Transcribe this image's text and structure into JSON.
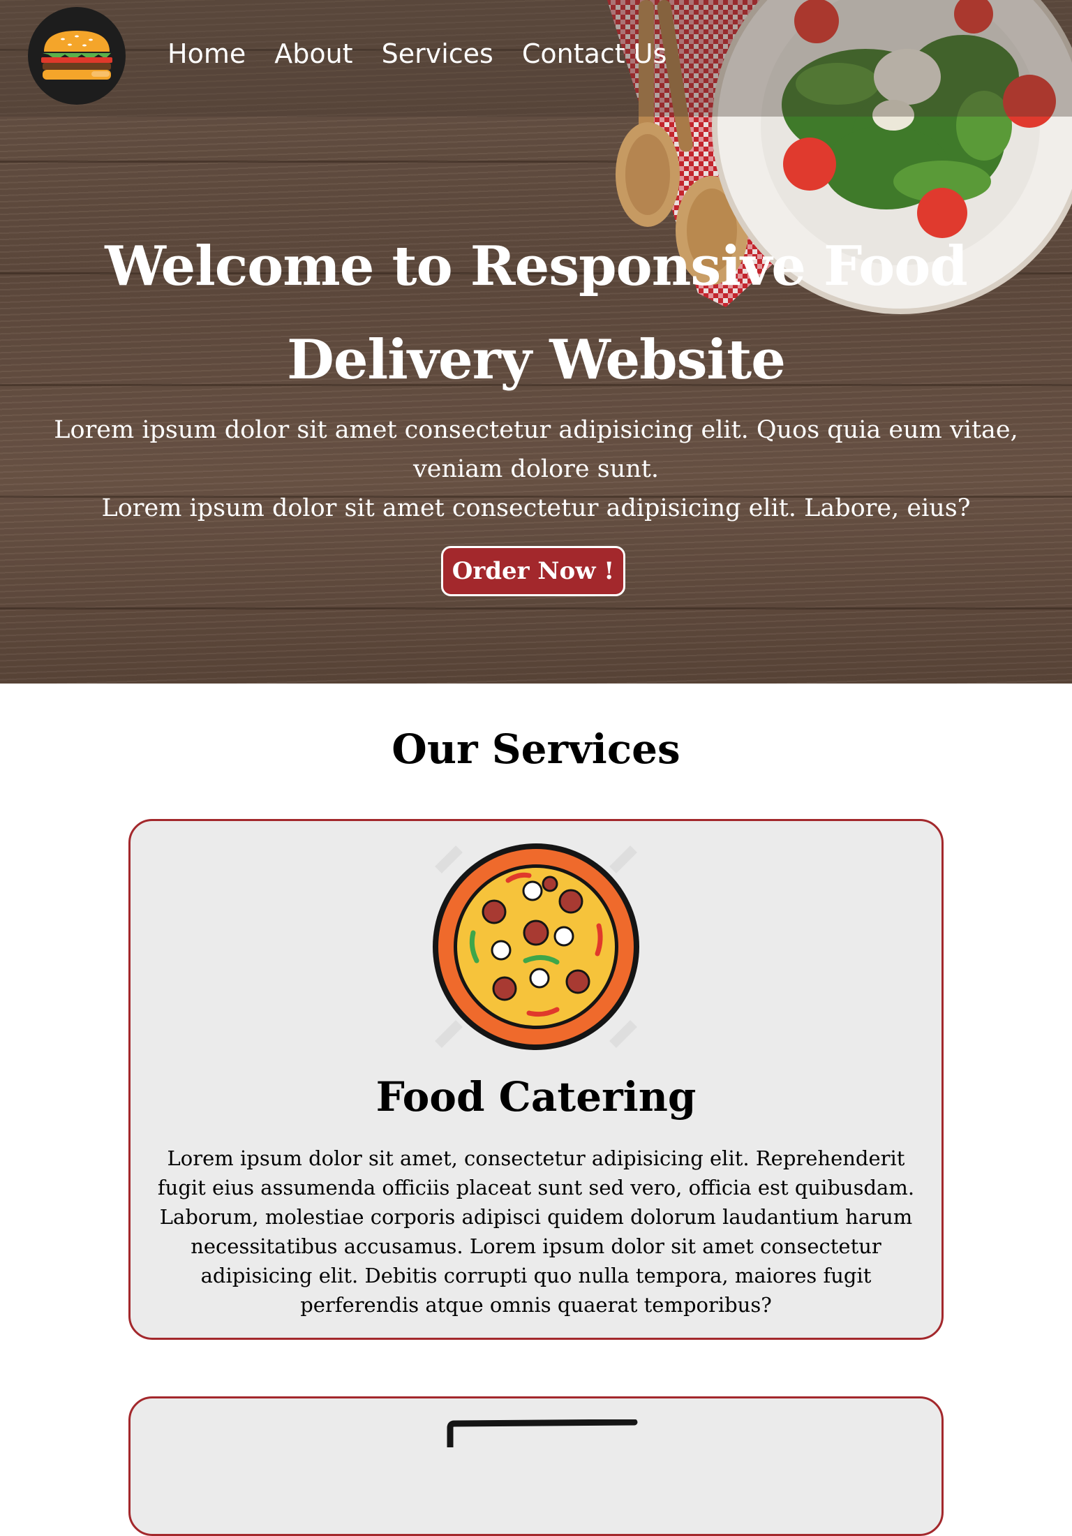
{
  "brand": {
    "logo_icon": "burger-icon"
  },
  "nav": {
    "items": [
      {
        "label": "Home"
      },
      {
        "label": "About"
      },
      {
        "label": "Services"
      },
      {
        "label": "Contact Us"
      }
    ]
  },
  "hero": {
    "title_line1": "Welcome to Responsive Food",
    "title_line2": "Delivery Website",
    "paragraph1": "Lorem ipsum dolor sit amet consectetur adipisicing elit. Quos quia eum vitae, veniam dolore sunt.",
    "paragraph2": "Lorem ipsum dolor sit amet consectetur adipisicing elit. Labore, eius?",
    "cta_label": "Order Now !"
  },
  "services": {
    "heading": "Our Services",
    "cards": [
      {
        "icon": "pizza-icon",
        "title": "Food Catering",
        "text": "Lorem ipsum dolor sit amet, consectetur adipisicing elit. Reprehenderit fugit eius assumenda officiis placeat sunt sed vero, officia est quibusdam. Laborum, molestiae corporis adipisci quidem dolorum laudantium harum necessitatibus accusamus. Lorem ipsum dolor sit amet consectetur adipisicing elit. Debitis corrupti quo nulla tempora, maiores fugit perferendis atque omnis quaerat temporibus?"
      },
      {
        "icon": "food-box-icon"
      }
    ]
  },
  "colors": {
    "accent": "#a3282c",
    "card_bg": "#ebebeb",
    "nav_text": "#ffffff"
  }
}
